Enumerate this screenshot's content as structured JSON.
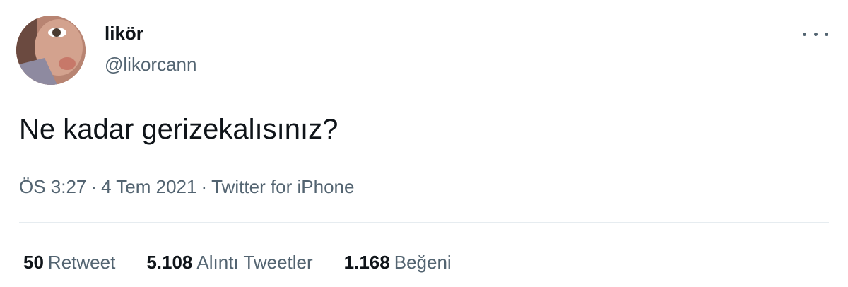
{
  "author": {
    "display_name": "likör",
    "handle": "@likorcann"
  },
  "tweet": {
    "text": "Ne kadar gerizekalısınız?",
    "time": "ÖS 3:27",
    "date": "4 Tem 2021",
    "source": "Twitter for iPhone",
    "separator": "·"
  },
  "stats": {
    "retweets": {
      "count": "50",
      "label": "Retweet"
    },
    "quotes": {
      "count": "5.108",
      "label": "Alıntı Tweetler"
    },
    "likes": {
      "count": "1.168",
      "label": "Beğeni"
    }
  },
  "icons": {
    "more": "more-horizontal-icon"
  },
  "colors": {
    "text_primary": "#0f1419",
    "text_secondary": "#536471",
    "divider": "#e6ecf0"
  }
}
